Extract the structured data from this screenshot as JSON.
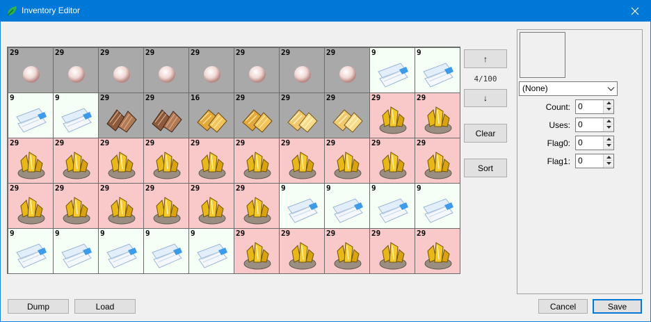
{
  "window": {
    "title": "Inventory Editor",
    "close_icon": "close-icon"
  },
  "grid": {
    "cells": [
      {
        "item": "pearl",
        "count": "29"
      },
      {
        "item": "pearl",
        "count": "29"
      },
      {
        "item": "pearl",
        "count": "29"
      },
      {
        "item": "pearl",
        "count": "29"
      },
      {
        "item": "pearl",
        "count": "29"
      },
      {
        "item": "pearl",
        "count": "29"
      },
      {
        "item": "pearl",
        "count": "29"
      },
      {
        "item": "pearl",
        "count": "29"
      },
      {
        "item": "ticket",
        "count": "9"
      },
      {
        "item": "ticket",
        "count": "9"
      },
      {
        "item": "ticket",
        "count": "9"
      },
      {
        "item": "ticket",
        "count": "9"
      },
      {
        "item": "wood",
        "count": "29"
      },
      {
        "item": "wood",
        "count": "29"
      },
      {
        "item": "goldbar",
        "count": "16"
      },
      {
        "item": "goldbar",
        "count": "29"
      },
      {
        "item": "goldbar2",
        "count": "29"
      },
      {
        "item": "goldbar2",
        "count": "29"
      },
      {
        "item": "gold",
        "count": "29"
      },
      {
        "item": "gold",
        "count": "29"
      },
      {
        "item": "gold",
        "count": "29"
      },
      {
        "item": "gold",
        "count": "29"
      },
      {
        "item": "gold",
        "count": "29"
      },
      {
        "item": "gold",
        "count": "29"
      },
      {
        "item": "gold",
        "count": "29"
      },
      {
        "item": "gold",
        "count": "29"
      },
      {
        "item": "gold",
        "count": "29"
      },
      {
        "item": "gold",
        "count": "29"
      },
      {
        "item": "gold",
        "count": "29"
      },
      {
        "item": "gold",
        "count": "29"
      },
      {
        "item": "gold",
        "count": "29"
      },
      {
        "item": "gold",
        "count": "29"
      },
      {
        "item": "gold",
        "count": "29"
      },
      {
        "item": "gold",
        "count": "29"
      },
      {
        "item": "gold",
        "count": "29"
      },
      {
        "item": "gold",
        "count": "29"
      },
      {
        "item": "ticket",
        "count": "9"
      },
      {
        "item": "ticket",
        "count": "9"
      },
      {
        "item": "ticket",
        "count": "9"
      },
      {
        "item": "ticket",
        "count": "9"
      },
      {
        "item": "ticket",
        "count": "9"
      },
      {
        "item": "ticket",
        "count": "9"
      },
      {
        "item": "ticket",
        "count": "9"
      },
      {
        "item": "ticket",
        "count": "9"
      },
      {
        "item": "ticket",
        "count": "9"
      },
      {
        "item": "gold",
        "count": "29"
      },
      {
        "item": "gold",
        "count": "29"
      },
      {
        "item": "gold",
        "count": "29"
      },
      {
        "item": "gold",
        "count": "29"
      },
      {
        "item": "gold",
        "count": "29"
      }
    ]
  },
  "nav": {
    "up_label": "↑",
    "down_label": "↓",
    "page": "4/100",
    "clear_label": "Clear",
    "sort_label": "Sort"
  },
  "details": {
    "item_select": "(None)",
    "count_label": "Count:",
    "count_value": "0",
    "uses_label": "Uses:",
    "uses_value": "0",
    "flag0_label": "Flag0:",
    "flag0_value": "0",
    "flag1_label": "Flag1:",
    "flag1_value": "0"
  },
  "footer": {
    "dump_label": "Dump",
    "load_label": "Load",
    "cancel_label": "Cancel",
    "save_label": "Save"
  },
  "colors": {
    "titlebar": "#0078d7",
    "pearl_bg": "#a9a9a9",
    "ticket_bg": "#f5fff5",
    "gold_bg": "#f9c8c8"
  }
}
